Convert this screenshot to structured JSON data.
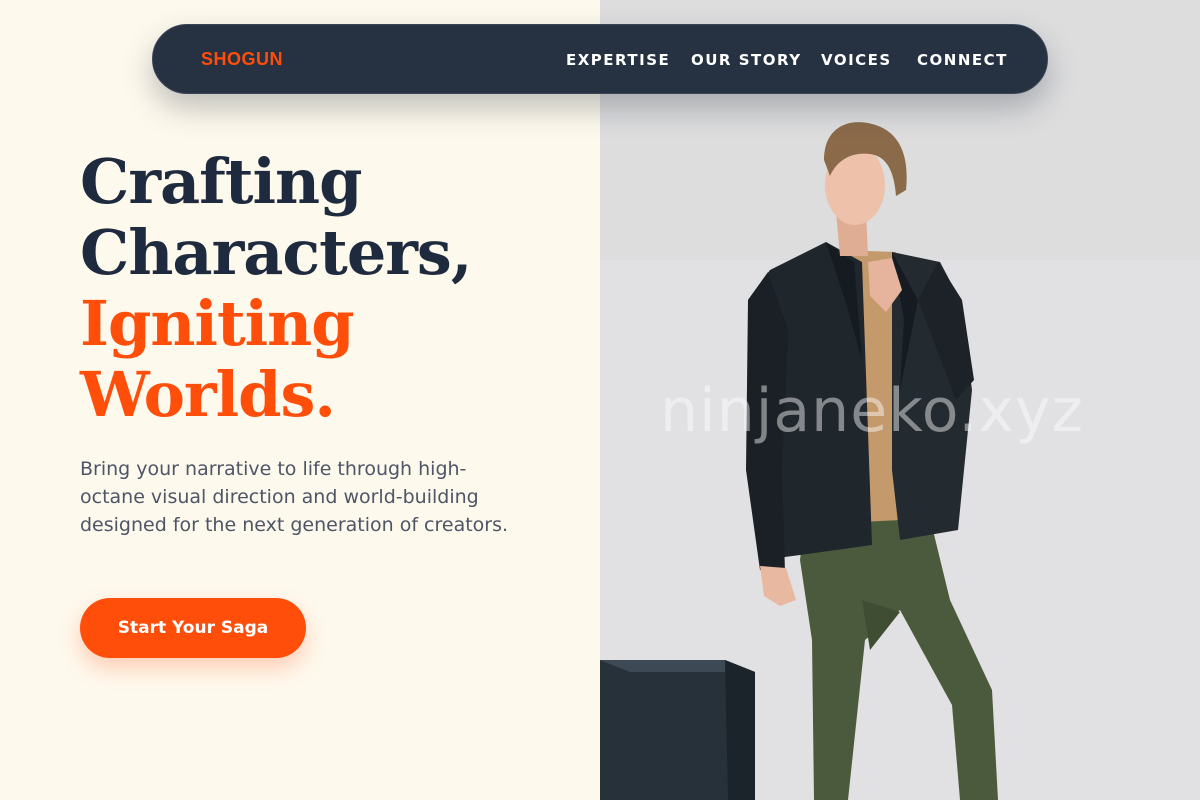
{
  "brand": {
    "name": "SHOGUN"
  },
  "nav": {
    "links": [
      {
        "label": "EXPERTISE"
      },
      {
        "label": "OUR STORY"
      },
      {
        "label": "VOICES"
      },
      {
        "label": "CONNECT"
      }
    ]
  },
  "hero": {
    "headline_line1": "Crafting",
    "headline_line2": "Characters,",
    "headline_accent_line1": "Igniting",
    "headline_accent_line2": "Worlds.",
    "description": "Bring your narrative to life through high-octane visual direction and world-building designed for the next generation of creators.",
    "cta_label": "Start Your Saga"
  },
  "photo": {
    "watermark": "ninjaneko.xyz"
  },
  "colors": {
    "accent": "#ff4d0a",
    "navy": "#1e2a3e",
    "nav_bg": "#263242",
    "page_bg": "#fef9ed"
  }
}
